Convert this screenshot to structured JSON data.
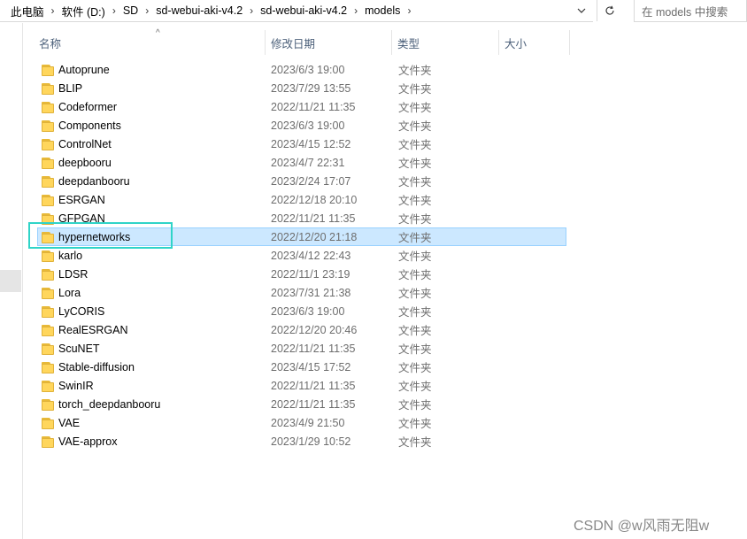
{
  "breadcrumb": [
    "此电脑",
    "软件 (D:)",
    "SD",
    "sd-webui-aki-v4.2",
    "sd-webui-aki-v4.2",
    "models"
  ],
  "search": {
    "placeholder": "在 models 中搜索"
  },
  "columns": {
    "name": "名称",
    "date": "修改日期",
    "type": "类型",
    "size": "大小"
  },
  "files": [
    {
      "name": "Autoprune",
      "date": "2023/6/3 19:00",
      "type": "文件夹"
    },
    {
      "name": "BLIP",
      "date": "2023/7/29 13:55",
      "type": "文件夹"
    },
    {
      "name": "Codeformer",
      "date": "2022/11/21 11:35",
      "type": "文件夹"
    },
    {
      "name": "Components",
      "date": "2023/6/3 19:00",
      "type": "文件夹"
    },
    {
      "name": "ControlNet",
      "date": "2023/4/15 12:52",
      "type": "文件夹"
    },
    {
      "name": "deepbooru",
      "date": "2023/4/7 22:31",
      "type": "文件夹"
    },
    {
      "name": "deepdanbooru",
      "date": "2023/2/24 17:07",
      "type": "文件夹"
    },
    {
      "name": "ESRGAN",
      "date": "2022/12/18 20:10",
      "type": "文件夹"
    },
    {
      "name": "GFPGAN",
      "date": "2022/11/21 11:35",
      "type": "文件夹"
    },
    {
      "name": "hypernetworks",
      "date": "2022/12/20 21:18",
      "type": "文件夹",
      "selected": true
    },
    {
      "name": "karlo",
      "date": "2023/4/12 22:43",
      "type": "文件夹"
    },
    {
      "name": "LDSR",
      "date": "2022/11/1 23:19",
      "type": "文件夹"
    },
    {
      "name": "Lora",
      "date": "2023/7/31 21:38",
      "type": "文件夹"
    },
    {
      "name": "LyCORIS",
      "date": "2023/6/3 19:00",
      "type": "文件夹"
    },
    {
      "name": "RealESRGAN",
      "date": "2022/12/20 20:46",
      "type": "文件夹"
    },
    {
      "name": "ScuNET",
      "date": "2022/11/21 11:35",
      "type": "文件夹"
    },
    {
      "name": "Stable-diffusion",
      "date": "2023/4/15 17:52",
      "type": "文件夹"
    },
    {
      "name": "SwinIR",
      "date": "2022/11/21 11:35",
      "type": "文件夹"
    },
    {
      "name": "torch_deepdanbooru",
      "date": "2022/11/21 11:35",
      "type": "文件夹"
    },
    {
      "name": "VAE",
      "date": "2023/4/9 21:50",
      "type": "文件夹"
    },
    {
      "name": "VAE-approx",
      "date": "2023/1/29 10:52",
      "type": "文件夹"
    }
  ],
  "watermark": "CSDN @w风雨无阻w",
  "colors": {
    "selection_bg": "#cce8ff",
    "selection_border": "#99d1ff",
    "highlight_box": "#2fd4c8",
    "folder": "#ffd65c"
  }
}
